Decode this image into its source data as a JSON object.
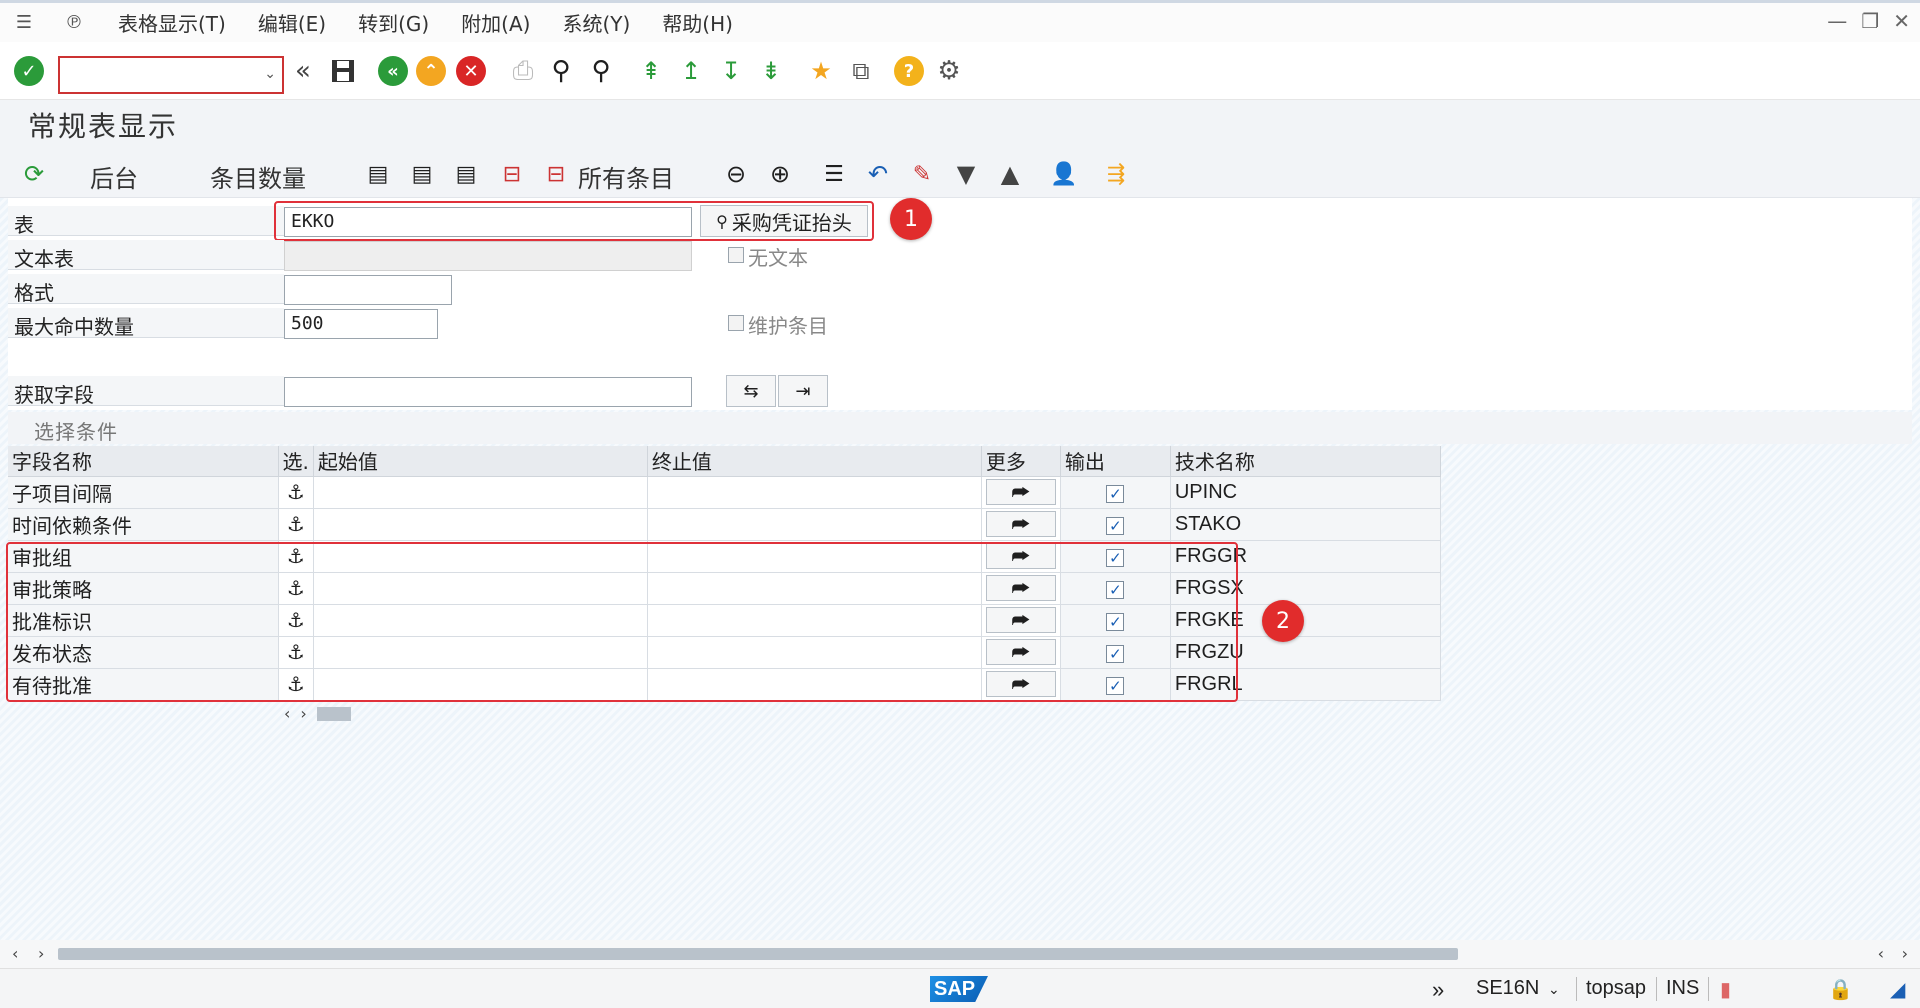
{
  "menu": {
    "items": [
      "表格显示(T)",
      "编辑(E)",
      "转到(G)",
      "附加(A)",
      "系统(Y)",
      "帮助(H)"
    ]
  },
  "toolbar": {
    "command_value": ""
  },
  "title": "常规表显示",
  "app_toolbar": {
    "background_label": "后台",
    "entry_count_label": "条目数量",
    "all_entries_label": "所有条目"
  },
  "form": {
    "table_label": "表",
    "table_value": "EKKO",
    "table_desc": "采购凭证抬头",
    "text_table_label": "文本表",
    "no_text_label": "无文本",
    "format_label": "格式",
    "max_hits_label": "最大命中数量",
    "max_hits_value": "500",
    "maintain_entries_label": "维护条目",
    "fetch_fields_label": "获取字段"
  },
  "selection": {
    "header": "选择条件",
    "columns": {
      "field_name": "字段名称",
      "sel": "选.",
      "from": "起始值",
      "to": "终止值",
      "more": "更多",
      "output": "输出",
      "tech": "技术名称"
    },
    "rows": [
      {
        "field": "子项目间隔",
        "tech": "UPINC",
        "output": true
      },
      {
        "field": "时间依赖条件",
        "tech": "STAKO",
        "output": true
      },
      {
        "field": "审批组",
        "tech": "FRGGR",
        "output": true
      },
      {
        "field": "审批策略",
        "tech": "FRGSX",
        "output": true
      },
      {
        "field": "批准标识",
        "tech": "FRGKE",
        "output": true
      },
      {
        "field": "发布状态",
        "tech": "FRGZU",
        "output": true
      },
      {
        "field": "有待批准",
        "tech": "FRGRL",
        "output": true
      }
    ]
  },
  "annotations": {
    "badge1": "1",
    "badge2": "2",
    "color": "#e0313a"
  },
  "status": {
    "logo": "SAP",
    "transaction": "SE16N",
    "system": "topsap",
    "mode": "INS"
  },
  "colors": {
    "accent_green": "#2b9b3a",
    "cancel_red": "#d92626",
    "exit_orange": "#f3a621",
    "link_blue": "#1a5fb4"
  }
}
